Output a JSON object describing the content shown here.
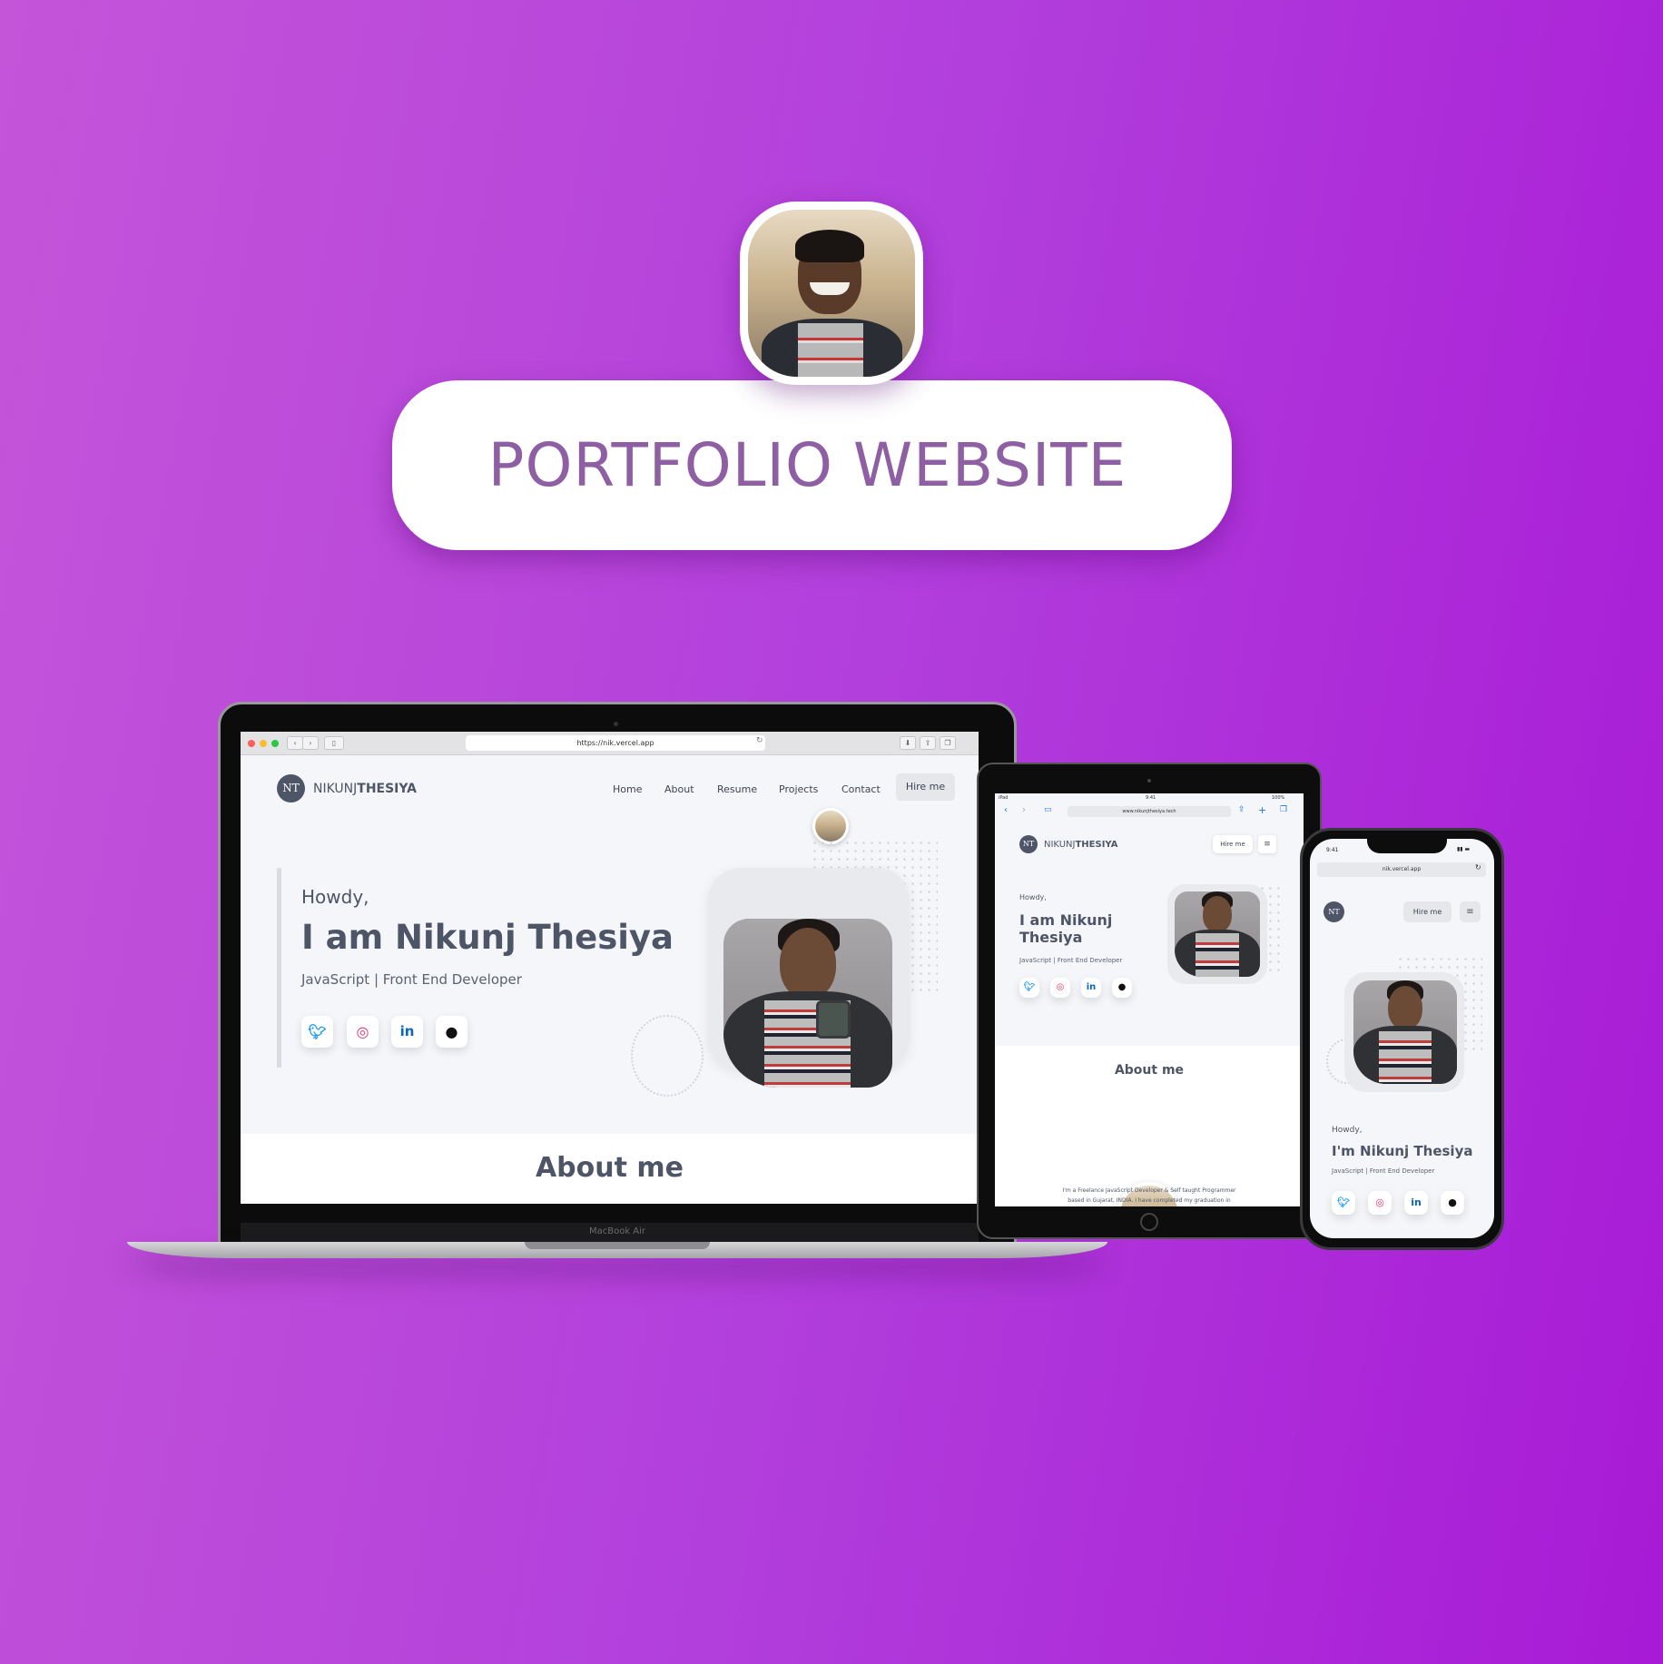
{
  "banner": {
    "title": "PORTFOLIO WEBSITE"
  },
  "laptop": {
    "device_label": "MacBook Air",
    "url": "https://nik.vercel.app",
    "brand_first": "NIKUNJ",
    "brand_last": "THESIYA",
    "logo_text": "NT",
    "nav": [
      "Home",
      "About",
      "Resume",
      "Projects",
      "Contact"
    ],
    "hire_label": "Hire me",
    "greeting": "Howdy,",
    "headline": "I am Nikunj Thesiya",
    "subtitle": "JavaScript | Front End Developer",
    "about_heading": "About me"
  },
  "tablet": {
    "status_left": "iPad",
    "status_time": "9:41",
    "status_right": "100%",
    "url": "www.nikunjthesiya.tech",
    "brand_first": "NIKUNJ",
    "brand_last": "THESIYA",
    "logo_text": "NT",
    "hire_label": "Hire me",
    "greeting": "Howdy,",
    "headline_line1": "I am Nikunj",
    "headline_line2": "Thesiya",
    "subtitle": "JavaScript | Front End Developer",
    "about_heading": "About me",
    "about_text_1": "I'm a Freelance JavaScript Developer & Self taught Programmer",
    "about_text_2": "based in Gujarat, INDIA. I have completed my graduation in"
  },
  "phone": {
    "status_time": "9:41",
    "url": "nik.vercel.app",
    "logo_text": "NT",
    "hire_label": "Hire me",
    "greeting": "Howdy,",
    "headline": "I'm Nikunj Thesiya",
    "subtitle": "JavaScript | Front End Developer"
  },
  "social_icons": [
    "twitter-icon",
    "instagram-icon",
    "linkedin-icon",
    "github-icon"
  ],
  "colors": {
    "twitter": "#1d9bf0",
    "instagram": "#e1306c",
    "linkedin": "#0a66c2",
    "github": "#111111",
    "heading": "#4d5566"
  }
}
